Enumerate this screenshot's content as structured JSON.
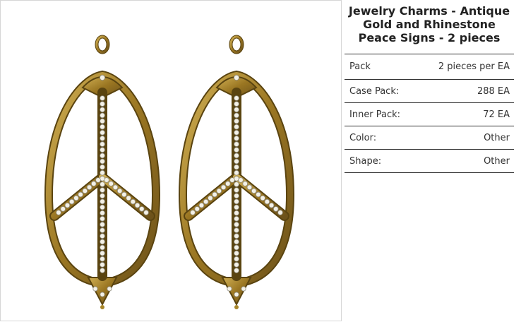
{
  "product": {
    "title": "Jewelry Charms - Antique Gold and Rhinestone Peace Signs - 2 pieces",
    "image_alt": "Two antique gold teardrop peace sign charms set with rhinestones"
  },
  "specs": [
    {
      "label": "Pack",
      "value": "2 pieces per EA"
    },
    {
      "label": "Case Pack:",
      "value": "288 EA"
    },
    {
      "label": "Inner Pack:",
      "value": "72 EA"
    },
    {
      "label": "Color:",
      "value": "Other"
    },
    {
      "label": "Shape:",
      "value": "Other"
    }
  ],
  "colors": {
    "gold": "#a8862a",
    "gold_dark": "#5a4410",
    "rhinestone": "#f4f1e6",
    "border": "#d6d6d6",
    "rule": "#333333"
  }
}
